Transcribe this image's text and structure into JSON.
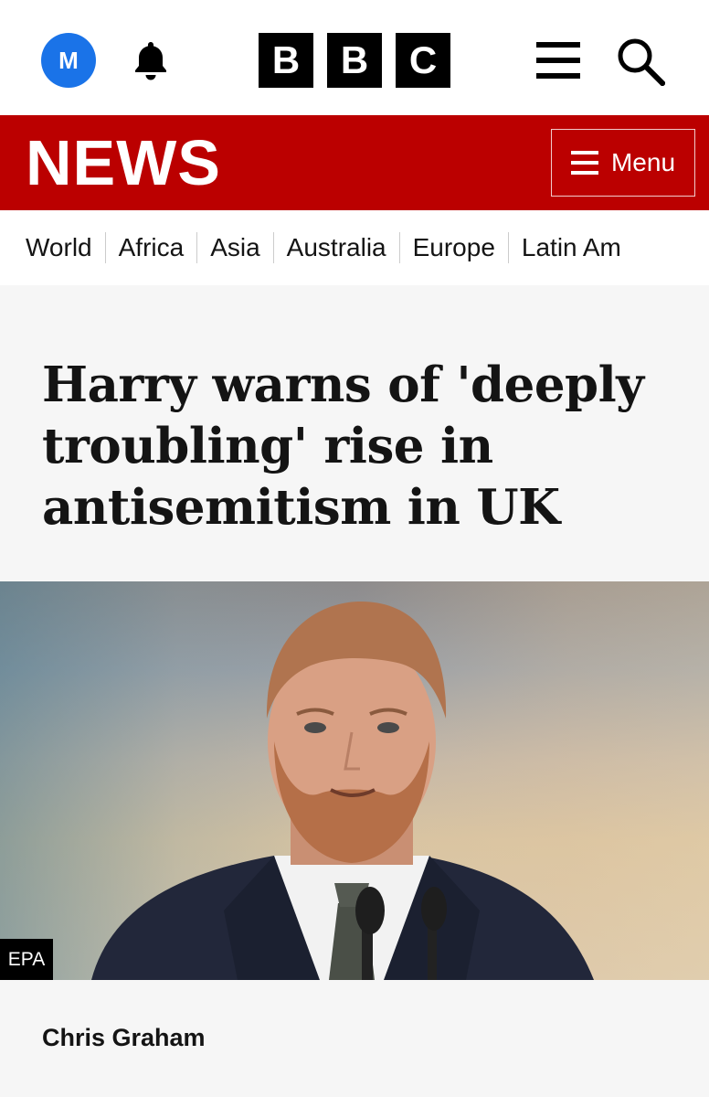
{
  "header": {
    "avatar_letter": "M",
    "brand_letters": [
      "B",
      "B",
      "C"
    ],
    "icons": {
      "notifications": "bell-icon",
      "menu": "hamburger-icon",
      "search": "search-icon"
    }
  },
  "news_bar": {
    "title": "NEWS",
    "menu_label": "Menu",
    "background": "#bb0000"
  },
  "subnav": {
    "items": [
      "World",
      "Africa",
      "Asia",
      "Australia",
      "Europe",
      "Latin Am"
    ]
  },
  "article": {
    "headline": "Harry warns of 'deeply troubling' rise in antisemitism in UK",
    "image_credit": "EPA",
    "byline": "Chris Graham"
  }
}
